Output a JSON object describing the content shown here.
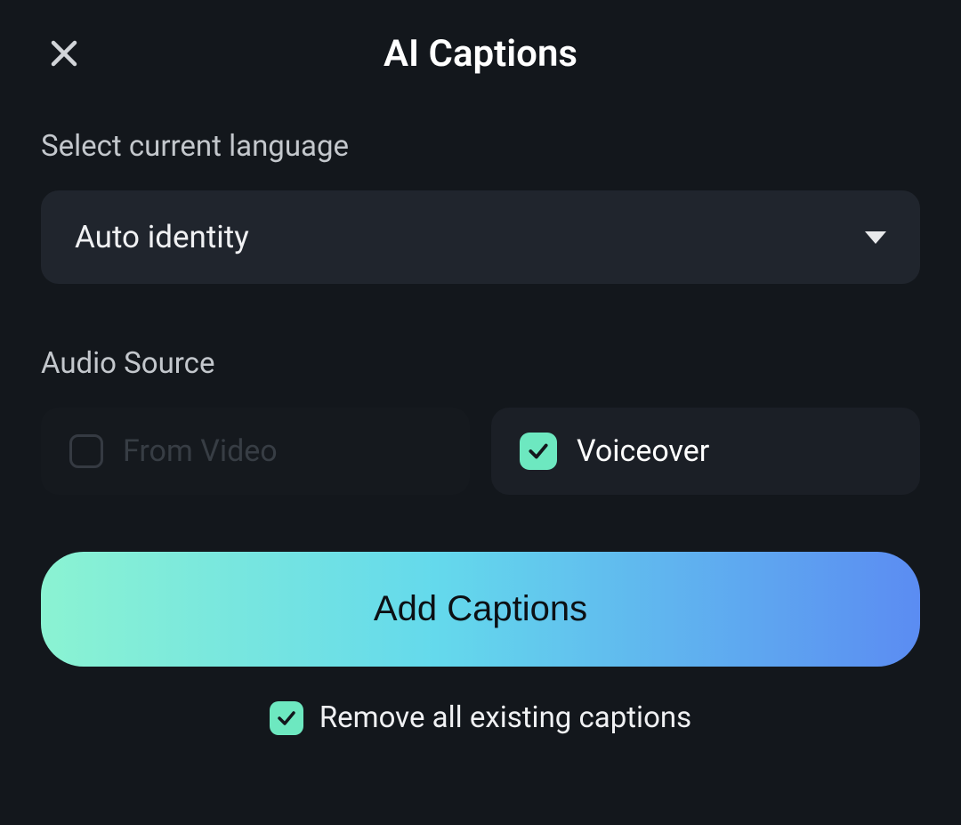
{
  "header": {
    "title": "AI Captions"
  },
  "language": {
    "section_label": "Select current language",
    "selected": "Auto identity"
  },
  "audio": {
    "section_label": "Audio Source",
    "from_video": {
      "label": "From Video",
      "checked": false,
      "disabled": true
    },
    "voiceover": {
      "label": "Voiceover",
      "checked": true,
      "disabled": false
    }
  },
  "actions": {
    "add_captions_label": "Add Captions",
    "remove_existing": {
      "label": "Remove all existing captions",
      "checked": true
    }
  },
  "colors": {
    "background": "#13171c",
    "card": "#20252d",
    "accent": "#6de8c0",
    "gradient_start": "#8bf3d2",
    "gradient_end": "#5b8cf2"
  }
}
